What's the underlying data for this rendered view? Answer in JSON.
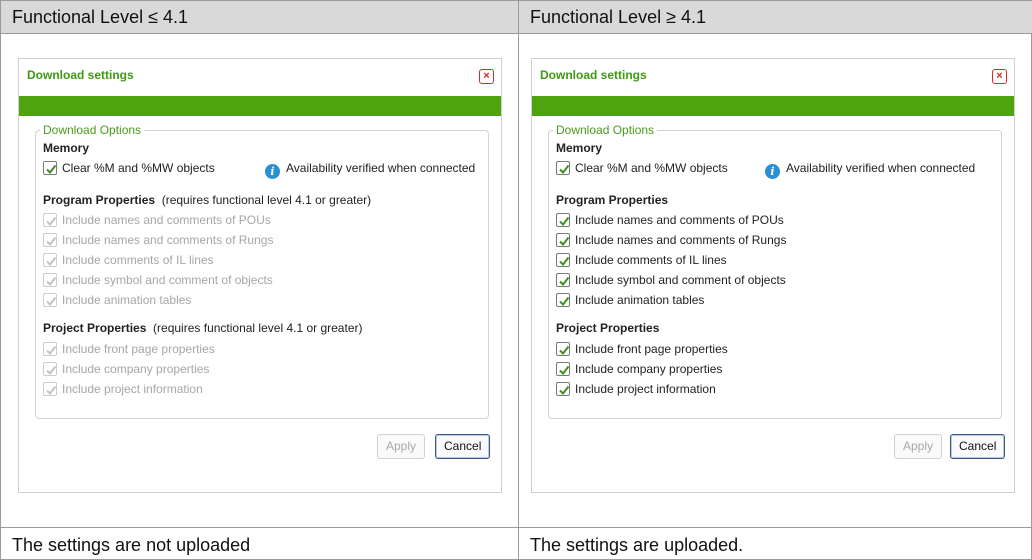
{
  "columns": [
    {
      "header": "Functional Level ≤ 4.1",
      "footer": "The settings are not uploaded",
      "dialog": {
        "title": "Download settings",
        "group_legend": "Download Options",
        "memory": {
          "title": "Memory",
          "clear_item": "Clear %M and %MW objects",
          "info_text": "Availability verified when connected"
        },
        "program": {
          "title": "Program Properties",
          "note": "(requires functional level 4.1 or greater)",
          "items": [
            "Include names and comments of POUs",
            "Include names and comments of Rungs",
            "Include comments of IL lines",
            "Include symbol and comment of objects",
            "Include animation tables"
          ]
        },
        "project": {
          "title": "Project Properties",
          "note": "(requires functional level 4.1 or greater)",
          "items": [
            "Include front page properties",
            "Include company properties",
            "Include project information"
          ]
        },
        "apply_label": "Apply",
        "cancel_label": "Cancel"
      }
    },
    {
      "header": "Functional Level ≥ 4.1",
      "footer": "The settings are uploaded.",
      "dialog": {
        "title": "Download settings",
        "group_legend": "Download Options",
        "memory": {
          "title": "Memory",
          "clear_item": "Clear %M and %MW objects",
          "info_text": "Availability verified when connected"
        },
        "program": {
          "title": "Program Properties",
          "items": [
            "Include names and comments of POUs",
            "Include names and comments of Rungs",
            "Include comments of IL lines",
            "Include symbol and comment of objects",
            "Include animation tables"
          ]
        },
        "project": {
          "title": "Project Properties",
          "items": [
            "Include front page properties",
            "Include company properties",
            "Include project information"
          ]
        },
        "apply_label": "Apply",
        "cancel_label": "Cancel"
      }
    }
  ],
  "colors": {
    "accent_green": "#4da40d",
    "title_green": "#3d9a12",
    "check_green": "#3f8f1f",
    "disabled_gray": "#a6a6a6",
    "info_blue": "#2b8fd6",
    "close_red": "#d12b2b"
  },
  "icons": {
    "close": "close-icon",
    "info": "info-icon",
    "check": "checkmark-icon"
  }
}
